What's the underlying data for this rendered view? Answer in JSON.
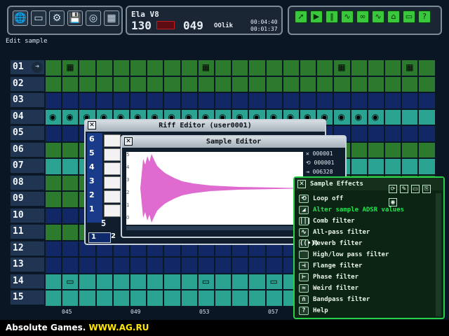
{
  "left_toolbar": {
    "icons": [
      "globe-icon",
      "screen-icon",
      "gear-icon",
      "floppy-icon",
      "disc-icon",
      "grid-icon"
    ]
  },
  "mid_panel": {
    "title": "Ela V8",
    "tempo": "130",
    "pattern": "049",
    "mode": "OOlik",
    "time1": "00:04:40",
    "time2": "00:01:37"
  },
  "right_toolbar": {
    "buttons": [
      "⯃",
      "▶",
      "■",
      "≀",
      "⍝",
      "∿",
      "∿",
      "⌂",
      "⌂",
      "⌂",
      "⌂",
      "?"
    ]
  },
  "status_text": "Edit sample",
  "rows": [
    "01",
    "02",
    "03",
    "04",
    "05",
    "06",
    "07",
    "08",
    "09",
    "10",
    "11",
    "12",
    "13",
    "14",
    "15"
  ],
  "riff_editor": {
    "title": "Riff Editor (user0001)",
    "keys": [
      "6",
      "5",
      "4",
      "3",
      "2",
      "1"
    ],
    "octave": "5",
    "page": "1",
    "page2": "2"
  },
  "sample_editor": {
    "title": "Sample Editor",
    "ruler": [
      "5",
      "4",
      "3",
      "2",
      "1",
      "0"
    ],
    "values": [
      "000001",
      "000001",
      "006328"
    ]
  },
  "sample_effects": {
    "title": "Sample Effects",
    "items": [
      {
        "label": "Loop off",
        "icon": "⟲",
        "selected": false
      },
      {
        "label": "Alter sample ADSR values",
        "icon": "◢",
        "selected": true
      },
      {
        "label": "Comb filter",
        "icon": "|||",
        "selected": false
      },
      {
        "label": "All-pass filter",
        "icon": "∿",
        "selected": false
      },
      {
        "label": "Reverb filter",
        "icon": "((•))",
        "selected": false
      },
      {
        "label": "High/low pass filter",
        "icon": "⁀",
        "selected": false
      },
      {
        "label": "Flange filter",
        "icon": "⊣",
        "selected": false
      },
      {
        "label": "Phase filter",
        "icon": "⊢",
        "selected": false
      },
      {
        "label": "Weird filter",
        "icon": "≈",
        "selected": false
      },
      {
        "label": "Bandpass filter",
        "icon": "∩",
        "selected": false
      },
      {
        "label": "Help",
        "icon": "?",
        "selected": false
      }
    ]
  },
  "markers": [
    "045",
    "049",
    "053",
    "057"
  ],
  "watermark": {
    "prefix": "Absolute Games.",
    "url": "WWW.AG.RU"
  }
}
